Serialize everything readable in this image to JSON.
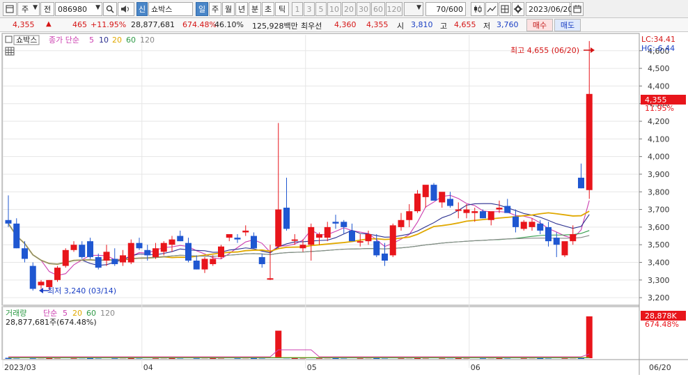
{
  "toolbar": {
    "type_label": "주",
    "prev_label": "전",
    "code_value": "086980",
    "sin_label": "신",
    "name_value": "쇼박스",
    "periods": [
      "일",
      "주",
      "월",
      "년",
      "분",
      "초",
      "틱"
    ],
    "active_period": "일",
    "minutes": [
      "1",
      "3",
      "5",
      "10",
      "20",
      "30",
      "60",
      "120"
    ],
    "count_value": "70",
    "count_total": "/600",
    "date_value": "2023/06/20"
  },
  "quote": {
    "price": "4,355",
    "up_arrow": "▲",
    "change": "465",
    "change_pct": "+11.95%",
    "volume": "28,877,681",
    "volume_ratio": "674.48%",
    "turnover_ratio": "46.10%",
    "amount": "125,928백만",
    "best_label": "최우선",
    "bid1": "4,360",
    "bid2": "4,355",
    "open_label": "시",
    "open": "3,810",
    "high_label": "고",
    "high": "4,655",
    "low_label": "저",
    "low": "3,760",
    "buy_label": "매수",
    "sell_label": "매도"
  },
  "colors": {
    "up": "#e8151b",
    "down": "#1f57d1",
    "ma5": "#cc3fb0",
    "ma10": "#2a2f8f",
    "ma20": "#e0a800",
    "ma60": "#2e9a46",
    "ma120": "#888888"
  },
  "price_panel": {
    "stock_name": "쇼박스",
    "legend_title": "종가 단순",
    "ma_periods": [
      "5",
      "10",
      "20",
      "60",
      "120"
    ],
    "lc_text": "LC:34.41",
    "hc_text": "HC:-6.44",
    "price_tag": "4,355",
    "pct_tag": "11.95%",
    "high_note": "최고 4,655 (06/20)",
    "low_note": "최저 3,240 (03/14)"
  },
  "volume_panel": {
    "legend_title": "거래량",
    "ma_label": "단순",
    "ma_periods": [
      "5",
      "20",
      "60",
      "120"
    ],
    "volume_text": "28,877,681주(674.48%)",
    "tag_volume": "28,878K",
    "tag_pct": "674.48%"
  },
  "chart_data": {
    "type": "candlestick",
    "y_ticks": [
      "4,600",
      "4,500",
      "4,400",
      "4,300",
      "4,200",
      "4,100",
      "4,000",
      "3,900",
      "3,800",
      "3,700",
      "3,600",
      "3,500",
      "3,400",
      "3,300",
      "3,200"
    ],
    "ylim": [
      3165,
      4690
    ],
    "x_labels": [
      {
        "index": 0,
        "label": "2023/03"
      },
      {
        "index": 17,
        "label": "04"
      },
      {
        "index": 37,
        "label": "05"
      },
      {
        "index": 57,
        "label": "06"
      },
      {
        "index": 76,
        "label": "06/20"
      }
    ],
    "candles": [
      [
        3640,
        3780,
        3600,
        3620
      ],
      [
        3620,
        3650,
        3480,
        3480
      ],
      [
        3480,
        3520,
        3400,
        3420
      ],
      [
        3380,
        3400,
        3240,
        3250
      ],
      [
        3270,
        3300,
        3250,
        3290
      ],
      [
        3260,
        3300,
        3240,
        3300
      ],
      [
        3300,
        3380,
        3290,
        3370
      ],
      [
        3380,
        3480,
        3370,
        3470
      ],
      [
        3470,
        3520,
        3460,
        3500
      ],
      [
        3500,
        3520,
        3420,
        3430
      ],
      [
        3520,
        3540,
        3420,
        3430
      ],
      [
        3430,
        3450,
        3360,
        3370
      ],
      [
        3410,
        3500,
        3380,
        3460
      ],
      [
        3420,
        3480,
        3380,
        3390
      ],
      [
        3400,
        3470,
        3380,
        3440
      ],
      [
        3400,
        3530,
        3390,
        3510
      ],
      [
        3510,
        3540,
        3470,
        3480
      ],
      [
        3470,
        3500,
        3410,
        3440
      ],
      [
        3430,
        3510,
        3420,
        3480
      ],
      [
        3460,
        3520,
        3440,
        3510
      ],
      [
        3500,
        3550,
        3460,
        3530
      ],
      [
        3550,
        3580,
        3520,
        3520
      ],
      [
        3510,
        3540,
        3400,
        3410
      ],
      [
        3410,
        3440,
        3360,
        3360
      ],
      [
        3360,
        3430,
        3340,
        3420
      ],
      [
        3390,
        3440,
        3380,
        3420
      ],
      [
        3430,
        3500,
        3420,
        3490
      ],
      [
        3540,
        3560,
        3520,
        3560
      ],
      [
        3540,
        3560,
        3510,
        3530
      ],
      [
        3570,
        3610,
        3550,
        3580
      ],
      [
        3550,
        3570,
        3480,
        3480
      ],
      [
        3430,
        3450,
        3370,
        3390
      ],
      [
        3310,
        3500,
        3300,
        3310
      ],
      [
        3490,
        4190,
        3480,
        3700
      ],
      [
        3710,
        3880,
        3580,
        3590
      ],
      [
        3530,
        3560,
        3500,
        3530
      ],
      [
        3480,
        3530,
        3460,
        3500
      ],
      [
        3500,
        3620,
        3410,
        3600
      ],
      [
        3540,
        3570,
        3500,
        3560
      ],
      [
        3540,
        3630,
        3520,
        3600
      ],
      [
        3630,
        3670,
        3590,
        3620
      ],
      [
        3630,
        3640,
        3560,
        3600
      ],
      [
        3580,
        3620,
        3520,
        3520
      ],
      [
        3520,
        3560,
        3490,
        3520
      ],
      [
        3520,
        3580,
        3500,
        3560
      ],
      [
        3520,
        3560,
        3430,
        3440
      ],
      [
        3450,
        3510,
        3380,
        3410
      ],
      [
        3440,
        3620,
        3430,
        3610
      ],
      [
        3600,
        3680,
        3580,
        3640
      ],
      [
        3640,
        3730,
        3600,
        3690
      ],
      [
        3690,
        3810,
        3680,
        3790
      ],
      [
        3770,
        3810,
        3710,
        3840
      ],
      [
        3840,
        3850,
        3750,
        3750
      ],
      [
        3740,
        3790,
        3710,
        3800
      ],
      [
        3760,
        3800,
        3710,
        3720
      ],
      [
        3700,
        3740,
        3650,
        3700
      ],
      [
        3680,
        3730,
        3650,
        3700
      ],
      [
        3680,
        3710,
        3630,
        3690
      ],
      [
        3690,
        3700,
        3650,
        3650
      ],
      [
        3640,
        3680,
        3610,
        3690
      ],
      [
        3700,
        3750,
        3680,
        3710
      ],
      [
        3720,
        3760,
        3680,
        3680
      ],
      [
        3660,
        3700,
        3570,
        3600
      ],
      [
        3590,
        3640,
        3580,
        3630
      ],
      [
        3600,
        3650,
        3580,
        3630
      ],
      [
        3620,
        3640,
        3560,
        3580
      ],
      [
        3600,
        3630,
        3490,
        3520
      ],
      [
        3540,
        3570,
        3430,
        3500
      ],
      [
        3440,
        3480,
        3430,
        3520
      ],
      [
        3520,
        3610,
        3500,
        3560
      ],
      [
        3880,
        3960,
        3820,
        3820
      ],
      [
        3810,
        4655,
        3760,
        4355
      ]
    ],
    "volume": {
      "spike_indices": [
        33,
        71
      ],
      "spike_values_k": [
        19000,
        28878
      ]
    }
  }
}
